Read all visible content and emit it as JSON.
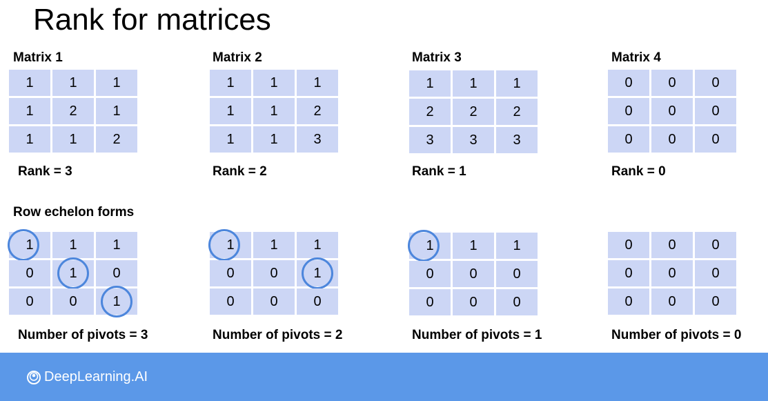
{
  "title": "Rank for matrices",
  "section_label": "Row echelon forms",
  "matrices": [
    {
      "name": "Matrix 1",
      "rows": [
        [
          "1",
          "1",
          "1"
        ],
        [
          "1",
          "2",
          "1"
        ],
        [
          "1",
          "1",
          "2"
        ]
      ],
      "rank_text": "Rank = 3",
      "echelon_rows": [
        [
          "1",
          "1",
          "1"
        ],
        [
          "0",
          "1",
          "0"
        ],
        [
          "0",
          "0",
          "1"
        ]
      ],
      "pivots_text": "Number of pivots = 3"
    },
    {
      "name": "Matrix 2",
      "rows": [
        [
          "1",
          "1",
          "1"
        ],
        [
          "1",
          "1",
          "2"
        ],
        [
          "1",
          "1",
          "3"
        ]
      ],
      "rank_text": "Rank = 2",
      "echelon_rows": [
        [
          "1",
          "1",
          "1"
        ],
        [
          "0",
          "0",
          "1"
        ],
        [
          "0",
          "0",
          "0"
        ]
      ],
      "pivots_text": "Number of pivots = 2"
    },
    {
      "name": "Matrix 3",
      "rows": [
        [
          "1",
          "1",
          "1"
        ],
        [
          "2",
          "2",
          "2"
        ],
        [
          "3",
          "3",
          "3"
        ]
      ],
      "rank_text": "Rank = 1",
      "echelon_rows": [
        [
          "1",
          "1",
          "1"
        ],
        [
          "0",
          "0",
          "0"
        ],
        [
          "0",
          "0",
          "0"
        ]
      ],
      "pivots_text": "Number of pivots = 1"
    },
    {
      "name": "Matrix 4",
      "rows": [
        [
          "0",
          "0",
          "0"
        ],
        [
          "0",
          "0",
          "0"
        ],
        [
          "0",
          "0",
          "0"
        ]
      ],
      "rank_text": "Rank = 0",
      "echelon_rows": [
        [
          "0",
          "0",
          "0"
        ],
        [
          "0",
          "0",
          "0"
        ],
        [
          "0",
          "0",
          "0"
        ]
      ],
      "pivots_text": "Number of pivots = 0"
    }
  ],
  "footer": {
    "logo_text": "DeepLearning.AI"
  },
  "colors": {
    "cell": "#ccd6f5",
    "pivot_circle": "#4c86dc",
    "footer": "#5b98e8"
  }
}
